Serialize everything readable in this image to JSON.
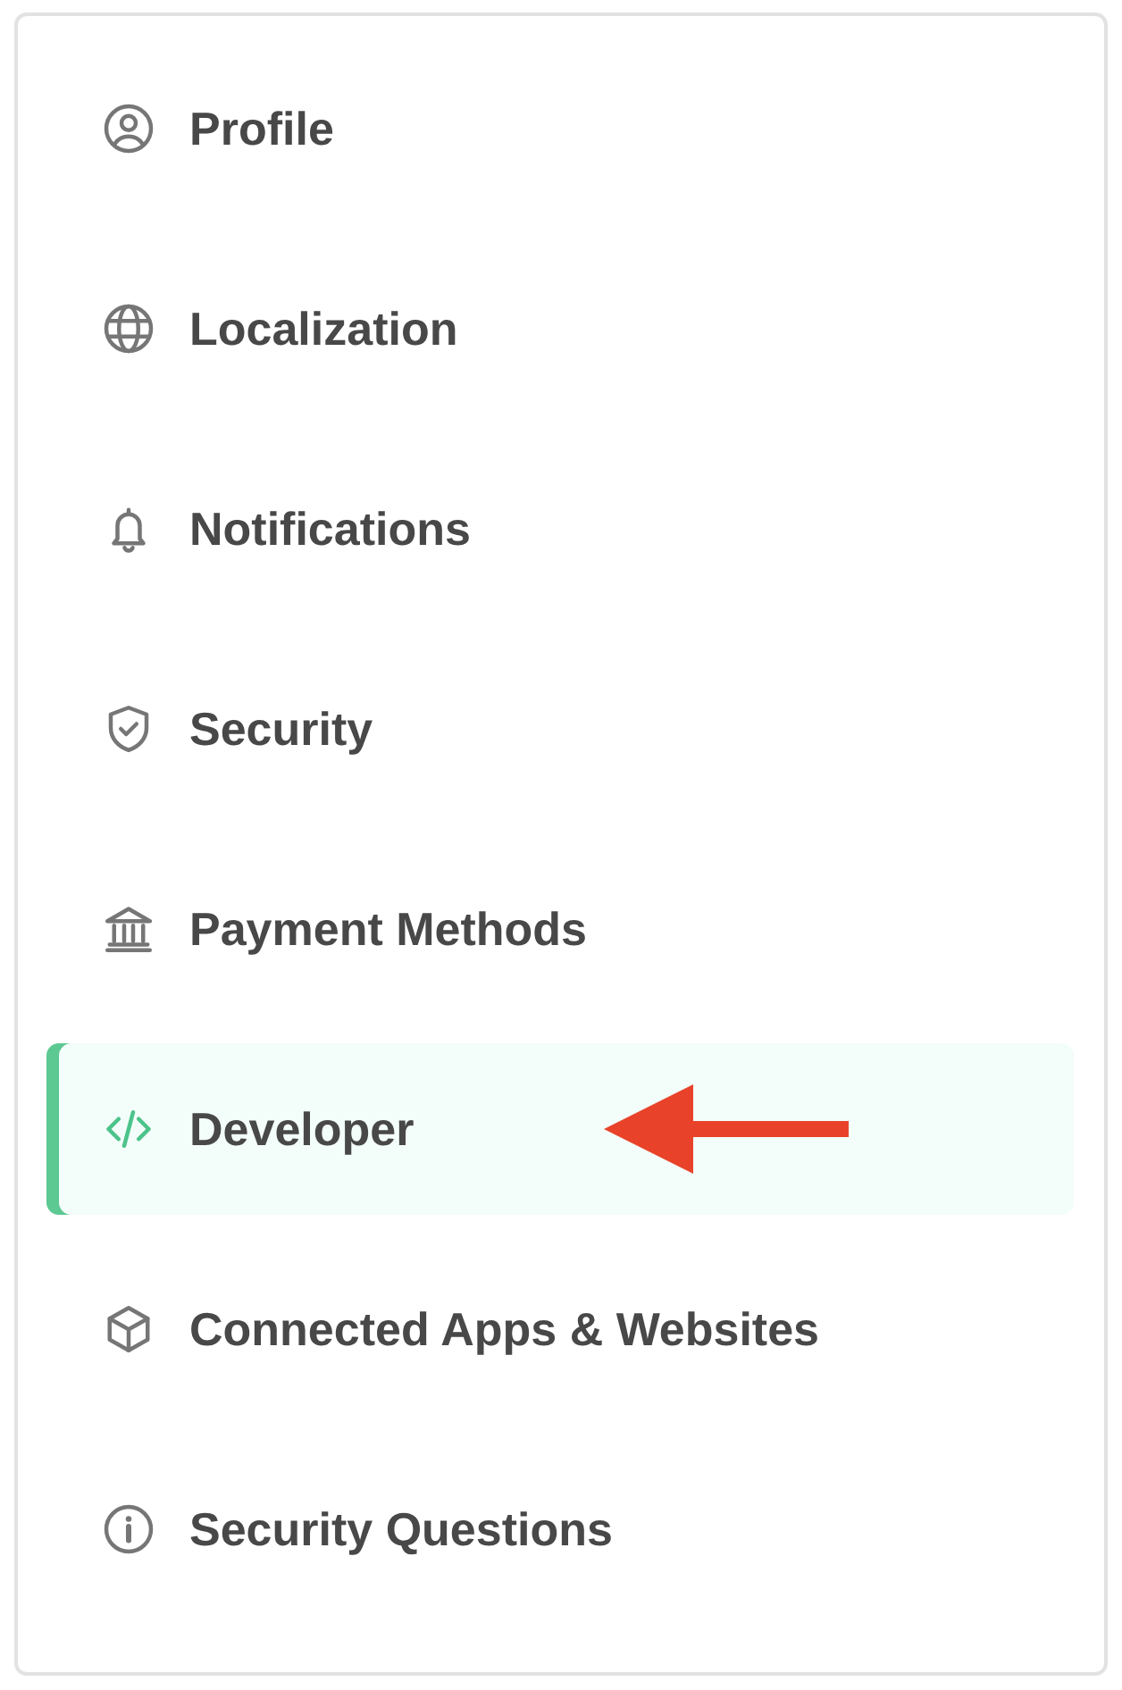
{
  "sidebar": {
    "items": [
      {
        "label": "Profile",
        "selected": false,
        "arrow_pointer": false
      },
      {
        "label": "Localization",
        "selected": false,
        "arrow_pointer": false
      },
      {
        "label": "Notifications",
        "selected": false,
        "arrow_pointer": false
      },
      {
        "label": "Security",
        "selected": false,
        "arrow_pointer": false
      },
      {
        "label": "Payment Methods",
        "selected": false,
        "arrow_pointer": false
      },
      {
        "label": "Developer",
        "selected": true,
        "arrow_pointer": true
      },
      {
        "label": "Connected Apps & Websites",
        "selected": false,
        "arrow_pointer": false
      },
      {
        "label": "Security Questions",
        "selected": false,
        "arrow_pointer": false
      }
    ]
  }
}
